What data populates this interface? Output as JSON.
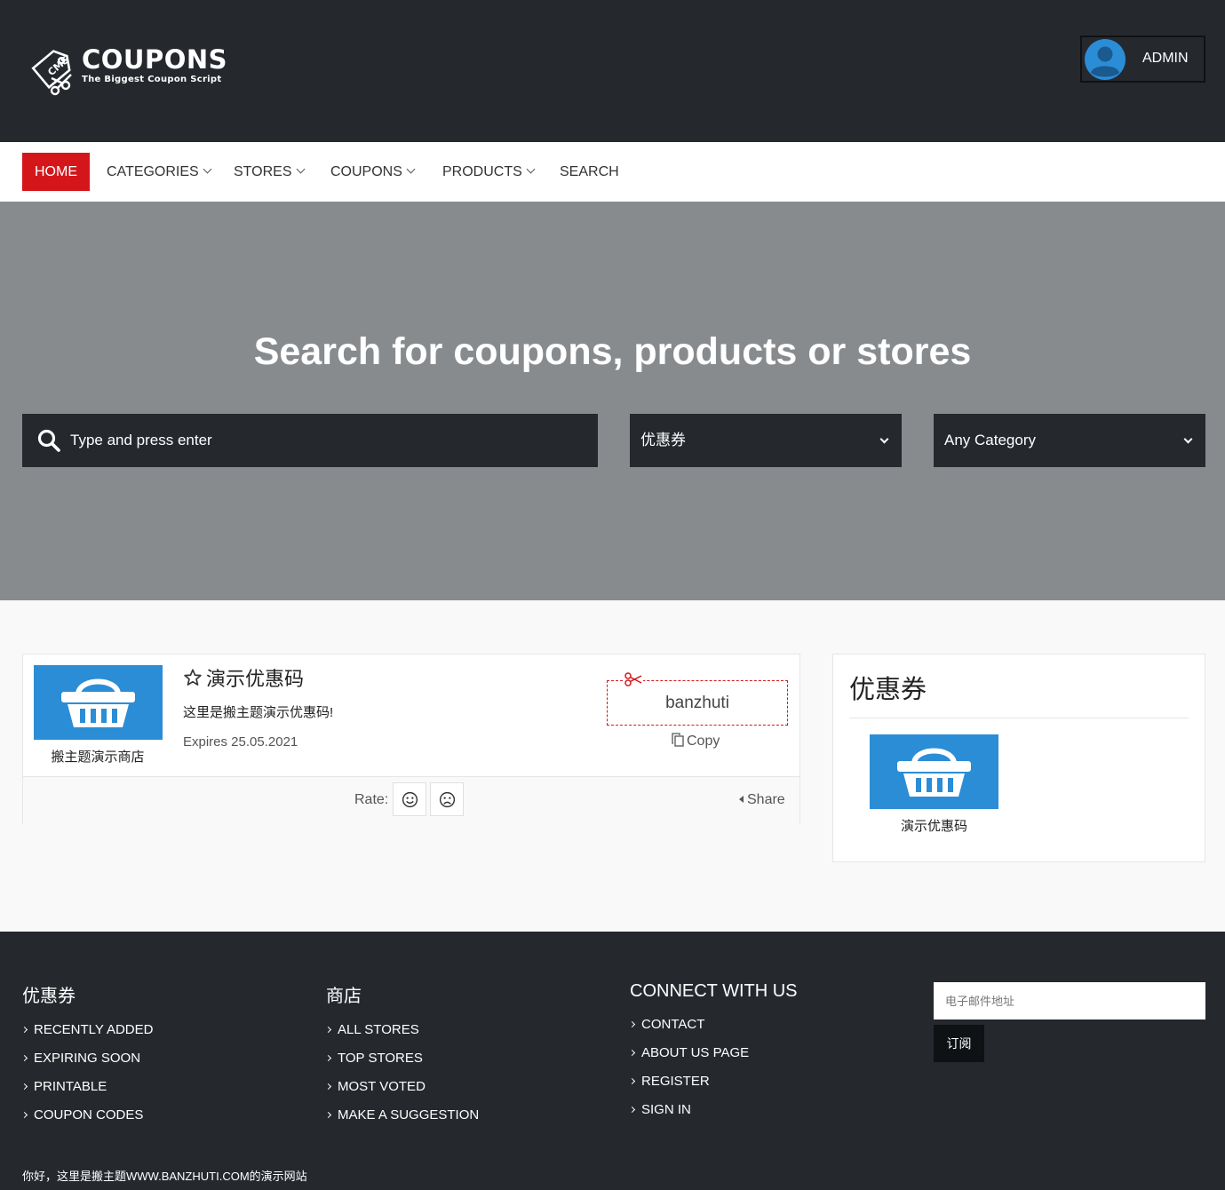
{
  "brand": {
    "name": "COUPONS",
    "tagline": "The Biggest Coupon Script",
    "badge": "CMS"
  },
  "header": {
    "user_label": "ADMIN"
  },
  "nav": {
    "items": [
      {
        "label": "HOME",
        "active": true,
        "dropdown": false
      },
      {
        "label": "CATEGORIES",
        "active": false,
        "dropdown": true
      },
      {
        "label": "STORES",
        "active": false,
        "dropdown": true
      },
      {
        "label": "COUPONS",
        "active": false,
        "dropdown": true
      },
      {
        "label": "PRODUCTS",
        "active": false,
        "dropdown": true
      },
      {
        "label": "SEARCH",
        "active": false,
        "dropdown": false
      }
    ]
  },
  "hero": {
    "title": "Search for coupons, products or stores",
    "search_placeholder": "Type and press enter",
    "type_select": "优惠券",
    "category_select": "Any Category"
  },
  "coupon": {
    "store_name": "搬主题演示商店",
    "title": "演示优惠码",
    "description": "这里是搬主题演示优惠码!",
    "expires": "Expires 25.05.2021",
    "code": "banzhuti",
    "copy_label": "Copy",
    "rate_label": "Rate:",
    "share_label": "Share"
  },
  "widget": {
    "title": "优惠券",
    "item_caption": "演示优惠码"
  },
  "footer": {
    "columns": [
      {
        "title": "优惠券",
        "links": [
          "RECENTLY ADDED",
          "EXPIRING SOON",
          "PRINTABLE",
          "COUPON CODES"
        ]
      },
      {
        "title": "商店",
        "links": [
          "ALL STORES",
          "TOP STORES",
          "MOST VOTED",
          "MAKE A SUGGESTION"
        ]
      },
      {
        "title": "CONNECT WITH US",
        "links": [
          "CONTACT",
          "ABOUT US PAGE",
          "REGISTER",
          "SIGN IN"
        ]
      }
    ],
    "email_placeholder": "电子邮件地址",
    "subscribe_label": "订阅",
    "copyright": "你好，这里是搬主题WWW.BANZHUTI.COM的演示网站"
  },
  "colors": {
    "dark": "#25292e",
    "accent_red": "#d4161b",
    "hero_gray": "#888b8e",
    "thumb_blue": "#2b8dd6"
  },
  "icons": [
    "cms-logo-icon",
    "user-avatar-icon",
    "search-icon",
    "chevron-down-icon",
    "shopping-basket-icon",
    "star-outline-icon",
    "scissors-icon",
    "copy-icon",
    "smile-icon",
    "frown-icon",
    "caret-left-icon",
    "chevron-right-icon"
  ]
}
